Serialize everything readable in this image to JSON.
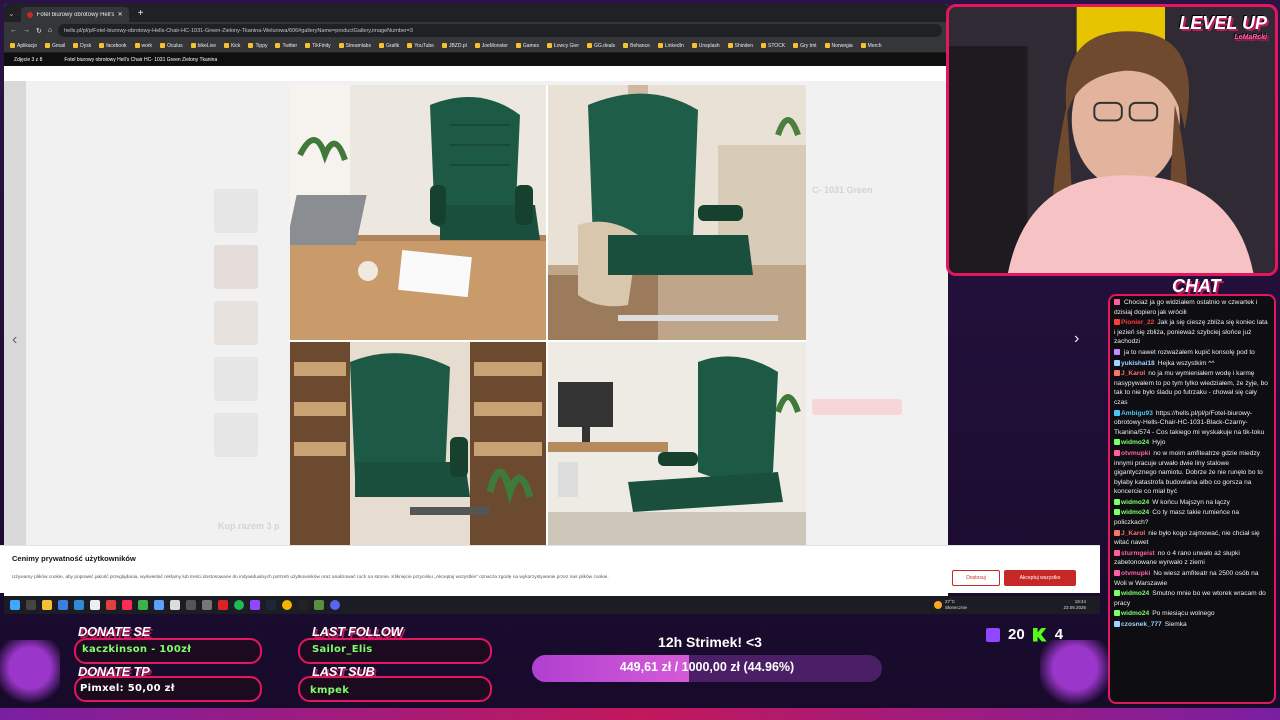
{
  "browser": {
    "tab_title": "Fotel biurowy obrotowy Hell's C",
    "url": "hells.pl/pl/p/Fotel-biurowy-obrotowy-Hells-Chair-HC-1031-Green-Zielony-Tkanina-Welurowa/606#galleryName=productGallery,imageNumber=3",
    "bookmarks": [
      "Aplikacje",
      "Gmail",
      "Dysk",
      "facebook",
      "work",
      "Oculus",
      "bikeLive",
      "Kick",
      "Tippy",
      "Twitter",
      "TikFinity",
      "Streamlabs",
      "Grafik",
      "YouTube",
      "JBZD.pl",
      "JoeMonster",
      "Games",
      "Łowcy Gier",
      "GG.deals",
      "Behance",
      "LinkedIn",
      "Unsplash",
      "Shinden",
      "STOCK",
      "Gry tmt",
      "Norwegia",
      "Merch"
    ],
    "gallery_counter": "Zdjęcie 3 z 8",
    "gallery_title": "Fotel biurowy obrotowy Hell's Chair HC- 1031 Green Zielony Tkanina",
    "bg_product_fragment": "C- 1031 Green",
    "bg_kup": "Kup razem 3 p"
  },
  "cookie": {
    "title": "Cenimy prywatność użytkowników",
    "text": "Używamy plików cookie, aby poprawić jakość przeglądania, wyświetlać reklamy lub treści dostosowane do indywidualnych potrzeb użytkowników oraz analizować ruch na stronie. Kliknięcie przycisku „Akceptuj wszystkie” oznacza zgodę na wykorzystywanie przez nas plików cookie.",
    "deny": "Dostosuj",
    "accept": "Akceptuj wszystko"
  },
  "taskbar": {
    "weather_temp": "27°C",
    "weather_desc": "Słonecznie",
    "time": "18:44",
    "date": "23.08.2026"
  },
  "cam": {
    "logo_line1": "LEVEL UP",
    "logo_line2": "LeMaRcki"
  },
  "chat": {
    "title": "CHAT",
    "messages": [
      {
        "user": "",
        "color": "#ff5fa2",
        "text": "Chociaż ja go widziałem ostatnio w czwartek i dzisiaj dopiero jak wróciłi"
      },
      {
        "user": "Pionier_22",
        "color": "#ff3b3b",
        "text": "Jak ja się cieszę zbliża się koniec lata i jezień się zbliża, ponieważ szybciej słońce już zachodzi"
      },
      {
        "user": "",
        "color": "#c48cff",
        "text": "ja to nawet rozważałem kupić konsolę pod to"
      },
      {
        "user": "yukishai18",
        "color": "#9fd2ff",
        "text": "Hejka wszystkim ^^"
      },
      {
        "user": "J_Karol",
        "color": "#ff7070",
        "text": "no ja mu wymieniałem wodę i karmę nasypywałem to po tym tylko wiedziałem, że żyje, bo tak to nie było śladu po futrzaku - chował się cały czas"
      },
      {
        "user": "Ambigu93",
        "color": "#4fc3f7",
        "text": "https://hells.pl/pl/p/Fotel-biurowy-obrotowy-Hells-Chair-HC-1031-Black-Czarny-Tkanina/574 - Cos takiego mi wyskakuje na tik-toku"
      },
      {
        "user": "widmo24",
        "color": "#7dff6b",
        "text": "Hyjo"
      },
      {
        "user": "otvmupki",
        "color": "#ff5fa2",
        "text": "no w moim amfiteatrze gdzie miedzy innymi pracuje urwało dwie liny stalowe gigantycznego namiotu. Dobrze że nie runęło bo to byłaby katastrofa budowlana albo co gorsza na koncercie co miał być"
      },
      {
        "user": "widmo24",
        "color": "#7dff6b",
        "text": "W końcu Majszyn na łączy"
      },
      {
        "user": "widmo24",
        "color": "#7dff6b",
        "text": "Co ty masz takie rumieńce na policzkach?"
      },
      {
        "user": "J_Karol",
        "color": "#ff7070",
        "text": "nie było kogo zajmować, nie chciał się witać nawet"
      },
      {
        "user": "sturmgeist",
        "color": "#ff5fa2",
        "text": "no o 4 rano urwało aż słupki zabetonowane wyrwało z ziemi"
      },
      {
        "user": "otvmupki",
        "color": "#ff5fa2",
        "text": "No wiesz amfiteatr na 2500 osób na Woli w Warszawie"
      },
      {
        "user": "widmo24",
        "color": "#7dff6b",
        "text": "Smutno mnie bo we wtorek wracam do pracy"
      },
      {
        "user": "widmo24",
        "color": "#7dff6b",
        "text": "Po miesiącu wolnego"
      },
      {
        "user": "czosnek_777",
        "color": "#9fd2ff",
        "text": "Siemka"
      }
    ]
  },
  "overlay": {
    "donate_se_label": "DONATE SE",
    "donate_se_value": "kaczkinson - 100zł",
    "donate_tp_label": "DONATE TP",
    "donate_tp_value": "Pimxel: 50,00 zł",
    "last_follow_label": "LAST FOLLOW",
    "last_follow_value": "Sailor_Elis",
    "last_sub_label": "LAST SUB",
    "last_sub_value": "kmpek",
    "goal_title": "12h Strimek! <3",
    "goal_text": "449,61 zł / 1000,00 zł (44.96%)",
    "goal_progress": 0.4496,
    "twitch_viewers": "20",
    "kick_viewers": "4"
  }
}
